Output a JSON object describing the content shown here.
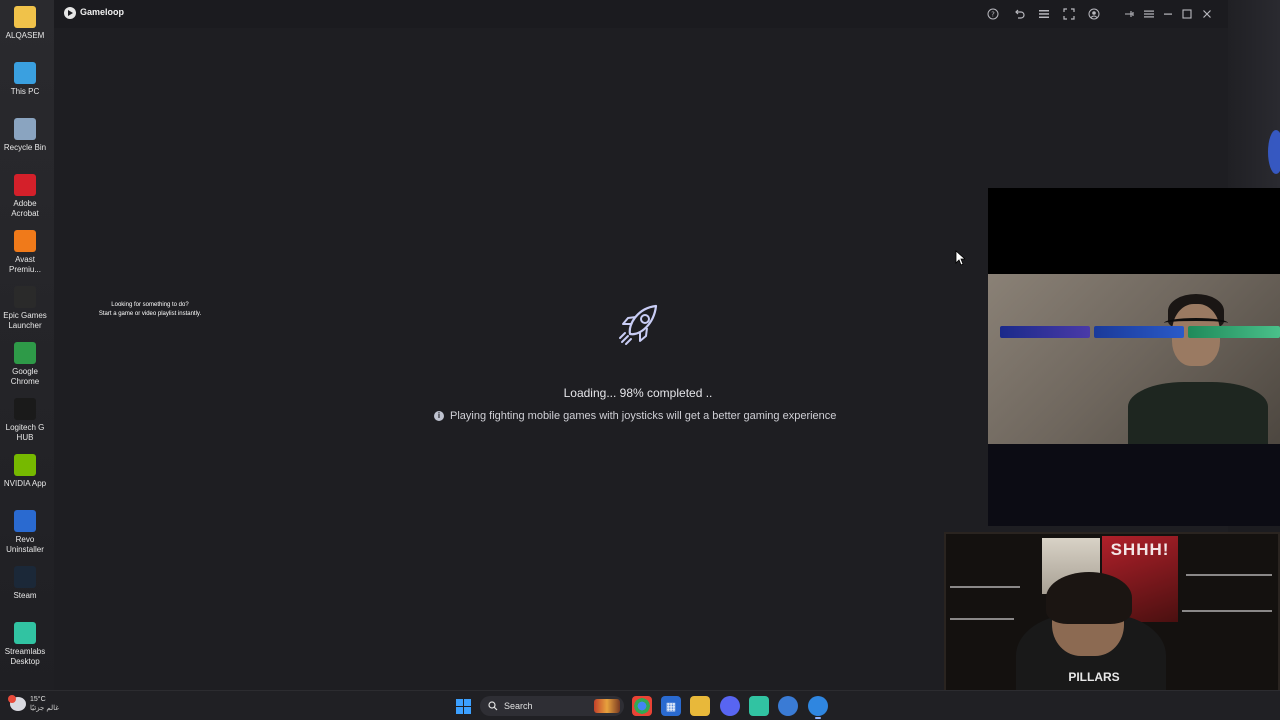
{
  "desktop": {
    "icons": [
      {
        "label": "ALQASEM",
        "icon": "folder-icon",
        "color": "#f0c24a"
      },
      {
        "label": "This PC",
        "icon": "monitor-icon",
        "color": "#3aa0e0"
      },
      {
        "label": "Recycle Bin",
        "icon": "recycle-bin-icon",
        "color": "#8aa4c0"
      },
      {
        "label": "Adobe Acrobat",
        "icon": "acrobat-icon",
        "color": "#d4202a"
      },
      {
        "label": "Avast Premiu...",
        "icon": "avast-icon",
        "color": "#f07a1a"
      },
      {
        "label": "Epic Games Launcher",
        "icon": "epic-games-icon",
        "color": "#2a2a2a"
      },
      {
        "label": "Google Chrome",
        "icon": "chrome-icon",
        "color": "#2e9a48"
      },
      {
        "label": "Logitech G HUB",
        "icon": "logitech-icon",
        "color": "#1a1a1a"
      },
      {
        "label": "NVIDIA App",
        "icon": "nvidia-icon",
        "color": "#76b900"
      },
      {
        "label": "Revo Uninstaller",
        "icon": "revo-icon",
        "color": "#2a6ad0"
      },
      {
        "label": "Steam",
        "icon": "steam-icon",
        "color": "#1b2838"
      },
      {
        "label": "Streamlabs Desktop",
        "icon": "streamlabs-icon",
        "color": "#31c3a2"
      }
    ]
  },
  "window": {
    "title": "Gameloop",
    "toolbar_icons": [
      "help-icon",
      "undo-icon",
      "list-icon",
      "fullscreen-icon",
      "account-icon",
      "pin-icon",
      "menu-icon",
      "minimize-icon",
      "maximize-icon",
      "close-icon"
    ]
  },
  "loading": {
    "status": "Loading... 98% completed ..",
    "progress_percent": 98,
    "tip": "Playing fighting mobile games with joysticks will get a better gaming experience"
  },
  "overlay": {
    "playlist_line1": "Looking for something to do?",
    "playlist_line2": "Start a game or video playlist instantly."
  },
  "webcam2": {
    "poster_text": "SHHH!",
    "hoodie_text": "PILLARS"
  },
  "taskbar": {
    "weather_temp": "15°C",
    "weather_desc": "غالم جزئيًا",
    "search_label": "Search",
    "accent": "#3ca0ff"
  }
}
